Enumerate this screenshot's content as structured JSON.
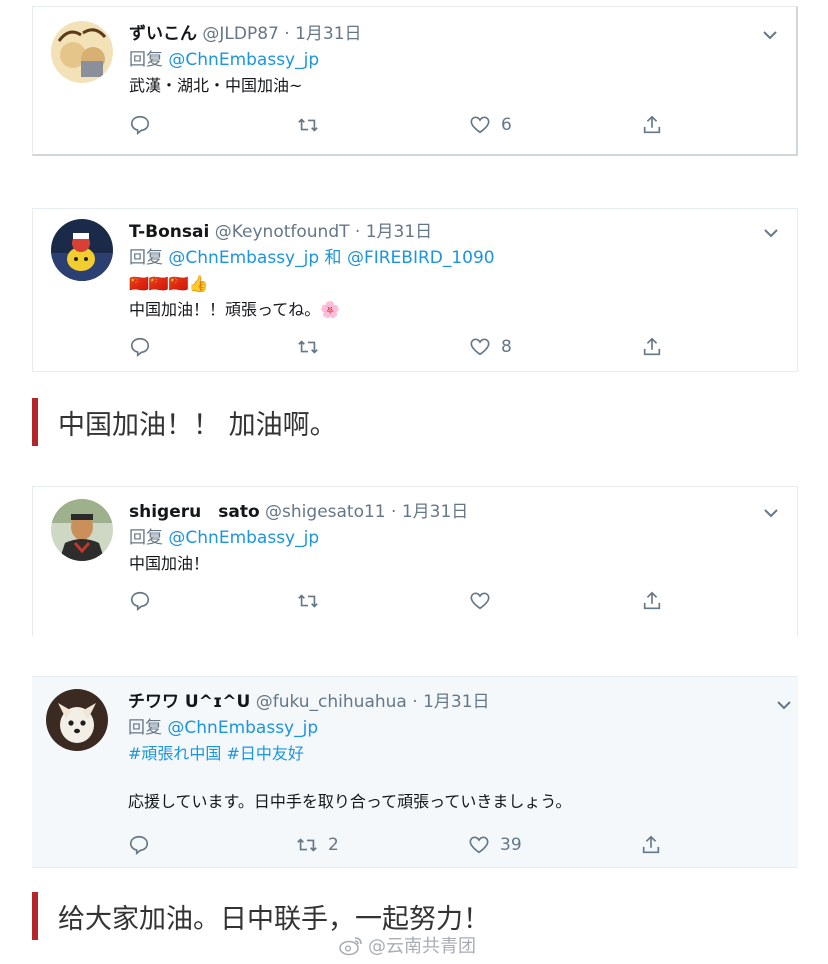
{
  "tweets": [
    {
      "name": "ずいこん",
      "handle": "@JLDP87",
      "dot": "·",
      "date": "1月31日",
      "reply_prefix": "回复",
      "reply_to": "@ChnEmbassy_jp",
      "reply_joiner": "",
      "reply_to2": "",
      "text": "武漢・湖北・中国加油~",
      "text2": "",
      "hashtags": "",
      "reply_count": "",
      "retweet_count": "",
      "like_count": "6"
    },
    {
      "name": "T-Bonsai",
      "handle": "@KeynotfoundT",
      "dot": "·",
      "date": "1月31日",
      "reply_prefix": "回复",
      "reply_to": "@ChnEmbassy_jp",
      "reply_joiner": "和",
      "reply_to2": "@FIREBIRD_1090",
      "emoji_line": "🇨🇳🇨🇳🇨🇳👍",
      "text": "中国加油！！頑張ってね。🌸",
      "like_count": "8"
    },
    {
      "name": "shigeru　sato",
      "handle": "@shigesato11",
      "dot": "·",
      "date": "1月31日",
      "reply_prefix": "回复",
      "reply_to": "@ChnEmbassy_jp",
      "text": "中国加油！",
      "like_count": ""
    },
    {
      "name": "チワワ U^ɪ^U",
      "handle": "@fuku_chihuahua",
      "dot": "·",
      "date": "1月31日",
      "reply_prefix": "回复",
      "reply_to": "@ChnEmbassy_jp",
      "hashtags": "#頑張れ中国 #日中友好",
      "text": "応援しています。日中手を取り合って頑張っていきましょう。",
      "retweet_count": "2",
      "like_count": "39"
    }
  ],
  "comments": [
    "中国加油！！ 加油啊。",
    "给大家加油。日中联手，一起努力！"
  ],
  "watermark": "@云南共青团",
  "icons": {
    "reply": "reply-icon",
    "retweet": "retweet-icon",
    "like": "heart-icon",
    "share": "share-icon",
    "more": "chevron-down-icon",
    "weibo": "weibo-logo-icon"
  },
  "colors": {
    "mention": "#1b95e0",
    "muted": "#657786",
    "accent_bar": "#b3262a",
    "highlight_bg": "#f5f8fa"
  }
}
